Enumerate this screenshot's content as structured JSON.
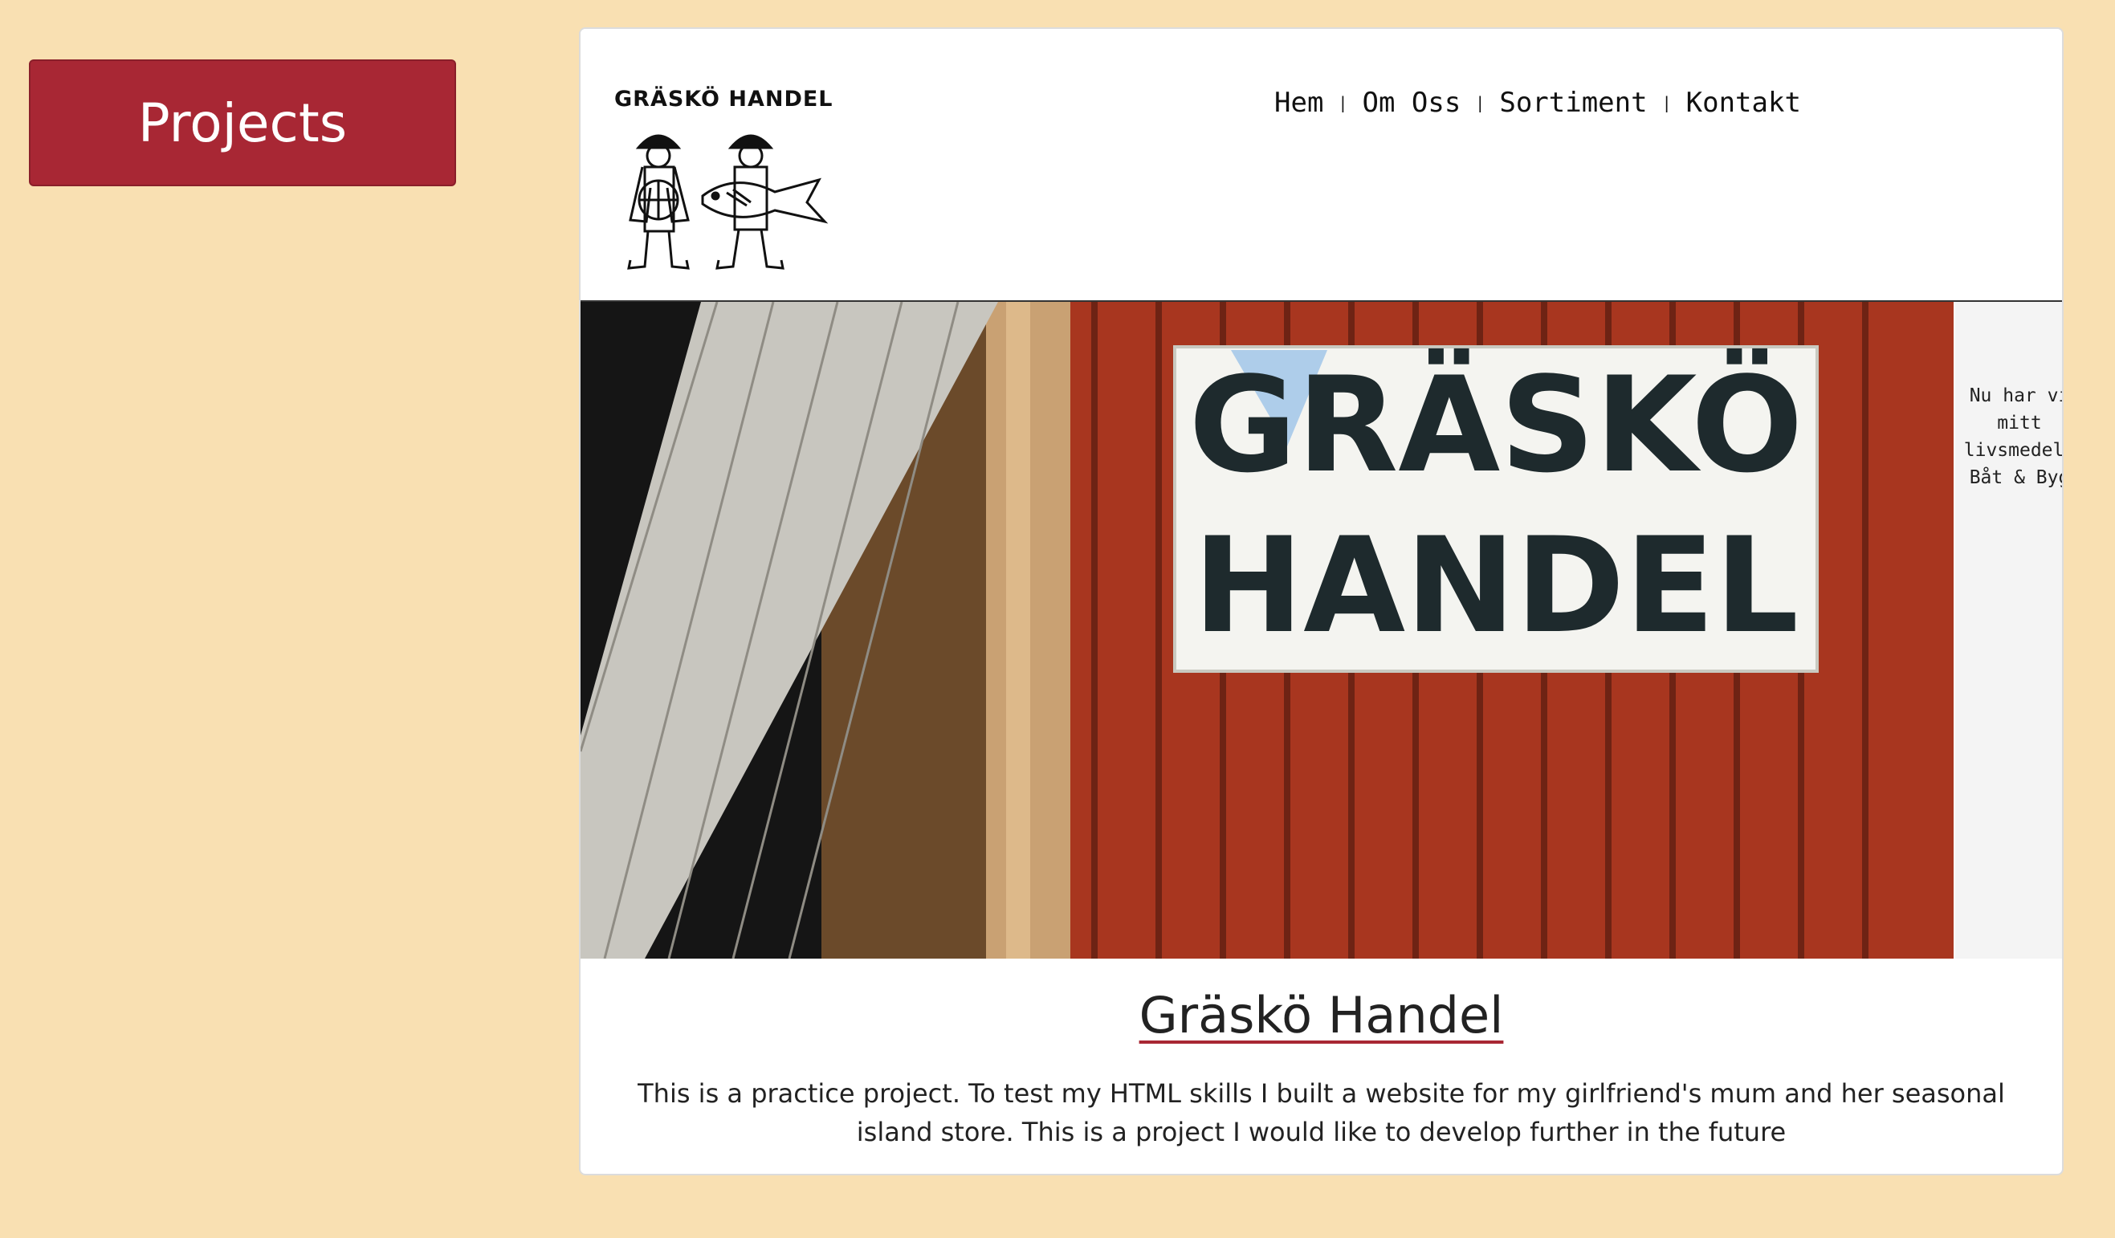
{
  "sidebar": {
    "projects_label": "Projects"
  },
  "project": {
    "title": "Gräskö Handel",
    "description": "This is a practice project. To test my HTML skills I built a website for my girlfriend's mum and her seasonal island store. This is a project I would like to develop further in the future"
  },
  "preview": {
    "logo_text": "GRÄSKÖ HANDEL",
    "nav": [
      "Hem",
      "Om Oss",
      "Sortiment",
      "Kontakt"
    ],
    "nav_separator": "|",
    "sign_line1": "GRÄSKÖ",
    "sign_line2": "HANDEL",
    "side_text": "Nu har vi\nmitt\nlivsmedel,\nBåt & Byg"
  },
  "colors": {
    "page_background": "#f9e0b2",
    "accent": "#a82734",
    "wall_red": "#a8361f"
  }
}
